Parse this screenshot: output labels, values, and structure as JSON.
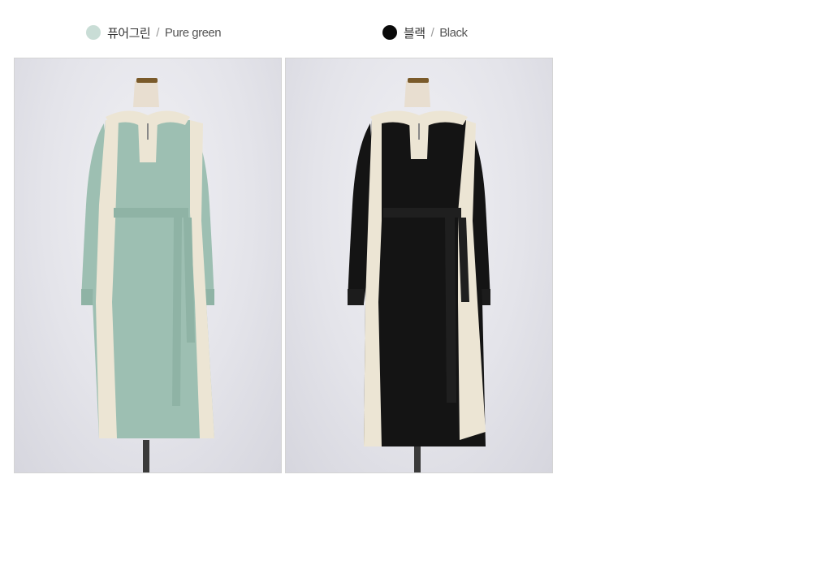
{
  "swatches": [
    {
      "korean": "퓨어그린",
      "separator": "/",
      "english": "Pure green",
      "color": "#c9ddd6"
    },
    {
      "korean": "블랙",
      "separator": "/",
      "english": "Black",
      "color": "#0a0a0a"
    }
  ],
  "products": [
    {
      "body_color": "#9dbfb2",
      "trim_color": "#ece5d4"
    },
    {
      "body_color": "#141414",
      "trim_color": "#ece5d4"
    }
  ]
}
